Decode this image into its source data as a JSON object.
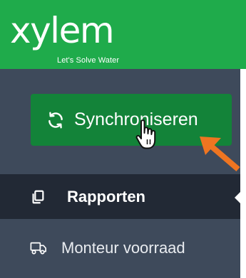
{
  "header": {
    "logo_text": "xylem",
    "tagline": "Let's Solve Water",
    "background": "#1fab4b"
  },
  "sync_button": {
    "label": "Synchroniseren",
    "icon": "refresh-icon",
    "background": "#138339"
  },
  "nav": {
    "items": [
      {
        "label": "Rapporten",
        "icon": "copy-icon",
        "active": true
      },
      {
        "label": "Monteur voorraad",
        "icon": "truck-icon",
        "active": false
      }
    ]
  },
  "annotation": {
    "arrow_color": "#ee7521"
  },
  "colors": {
    "sidebar": "#3e4a5b",
    "active_item": "#222935"
  }
}
